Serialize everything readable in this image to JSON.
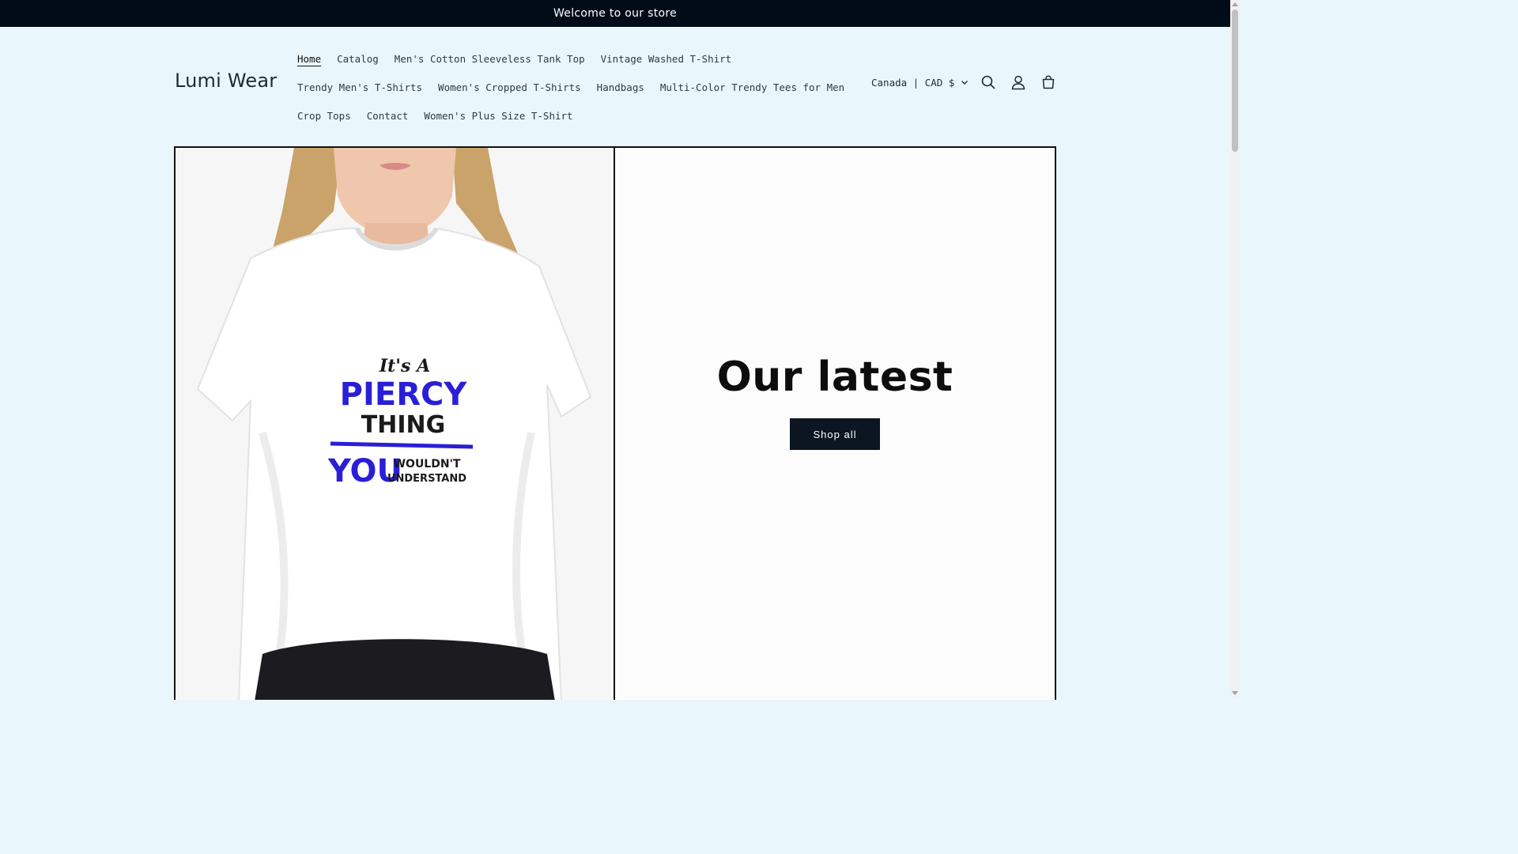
{
  "announcement": {
    "text": "Welcome to our store"
  },
  "header": {
    "logo": "Lumi Wear",
    "nav_rows": [
      [
        {
          "label": "Home",
          "active": true
        },
        {
          "label": "Catalog"
        },
        {
          "label": "Men's Cotton Sleeveless Tank Top"
        },
        {
          "label": "Vintage Washed T-Shirt"
        }
      ],
      [
        {
          "label": "Trendy Men's T-Shirts"
        },
        {
          "label": "Women's Cropped T-Shirts"
        },
        {
          "label": "Handbags"
        },
        {
          "label": "Multi-Color Trendy Tees for Men"
        }
      ],
      [
        {
          "label": "Crop Tops"
        },
        {
          "label": "Contact"
        },
        {
          "label": "Women's Plus Size T-Shirt"
        }
      ]
    ],
    "country_selector": "Canada | CAD $",
    "icons": [
      "search-icon",
      "account-icon",
      "cart-icon"
    ]
  },
  "hero": {
    "title": "Our latest",
    "button_label": "Shop all",
    "shirt_print": {
      "line1": "It's A",
      "line2": "PIERCY",
      "line3": "THING",
      "line4": "YOU",
      "line5": "WOULDN'T",
      "line6": "UNDERSTAND"
    }
  },
  "colors": {
    "background": "#e9f7fd",
    "announcement_bar": "#020c18",
    "button": "#0c1622",
    "print_accent": "#2a1fd6"
  }
}
